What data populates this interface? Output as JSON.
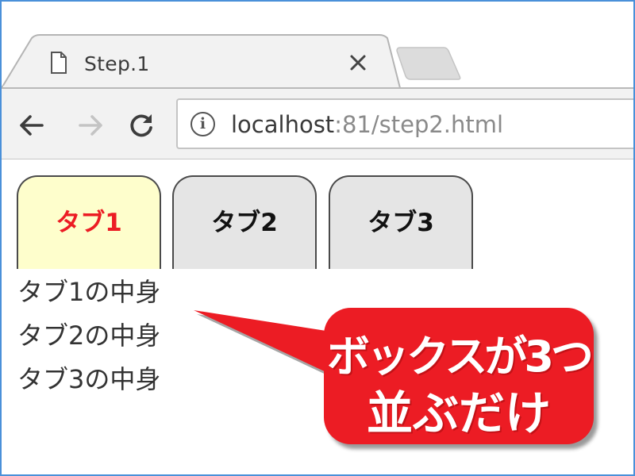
{
  "browser": {
    "tab_title": "Step.1",
    "close_glyph": "✕",
    "url": {
      "host": "localhost",
      "rest": ":81/step2.html"
    },
    "icons": {
      "page": "document-icon",
      "close": "close-icon",
      "back": "back-arrow-icon",
      "forward": "forward-arrow-icon",
      "reload": "reload-icon",
      "info": "info-icon"
    },
    "info_glyph": "i"
  },
  "page": {
    "tabs": [
      {
        "label": "タブ1",
        "active": true
      },
      {
        "label": "タブ2",
        "active": false
      },
      {
        "label": "タブ3",
        "active": false
      }
    ],
    "contents": [
      "タブ1の中身",
      "タブ2の中身",
      "タブ3の中身"
    ]
  },
  "callout": {
    "line1": "ボックスが3つ",
    "line2": "並ぶだけ"
  },
  "colors": {
    "active_tab_bg": "#fefecc",
    "active_tab_text": "#ec1c24",
    "inactive_tab_bg": "#e5e5e5",
    "callout_bg": "#ec1c24",
    "toolbar_bg": "#f2f2f2"
  }
}
